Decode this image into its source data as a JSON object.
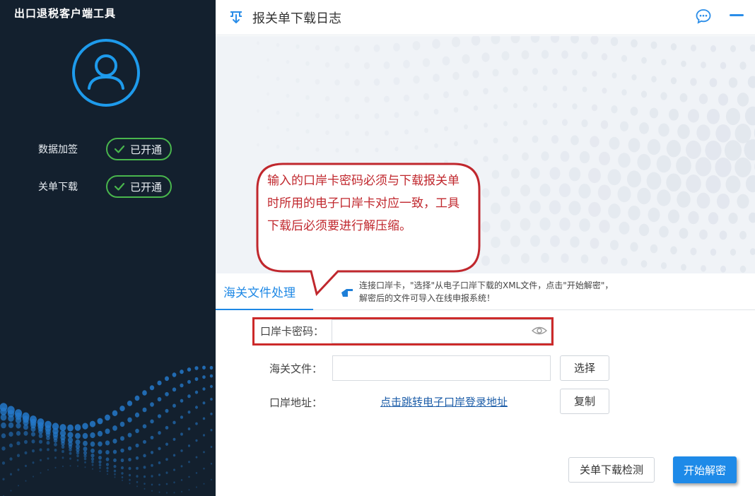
{
  "sidebar": {
    "app_title": "出口退税客户端工具",
    "features": [
      {
        "label": "数据加签",
        "status": "已开通"
      },
      {
        "label": "关单下载",
        "status": "已开通"
      }
    ]
  },
  "header": {
    "title": "报关单下载日志"
  },
  "annotation": {
    "text": "输入的口岸卡密码必须与下载报关单时所用的电子口岸卡对应一致，工具下载后必须要进行解压缩。"
  },
  "tabs": {
    "active_label": "海关文件处理",
    "hint_line1": "连接口岸卡，\"选择\"从电子口岸下载的XML文件，点击\"开始解密\"，",
    "hint_line2": "解密后的文件可导入在线申报系统！"
  },
  "form": {
    "password_label": "口岸卡密码：",
    "password_value": "",
    "file_label": "海关文件：",
    "file_value": "",
    "select_label": "选择",
    "port_label": "口岸地址：",
    "port_link": "点击跳转电子口岸登录地址",
    "copy_label": "复制"
  },
  "actions": {
    "check_label": "关单下载检测",
    "start_label": "开始解密"
  },
  "colors": {
    "sidebar_bg": "#13202e",
    "accent": "#1e8ae8",
    "status_green": "#49b64d",
    "annotation_red": "#c0272d"
  }
}
